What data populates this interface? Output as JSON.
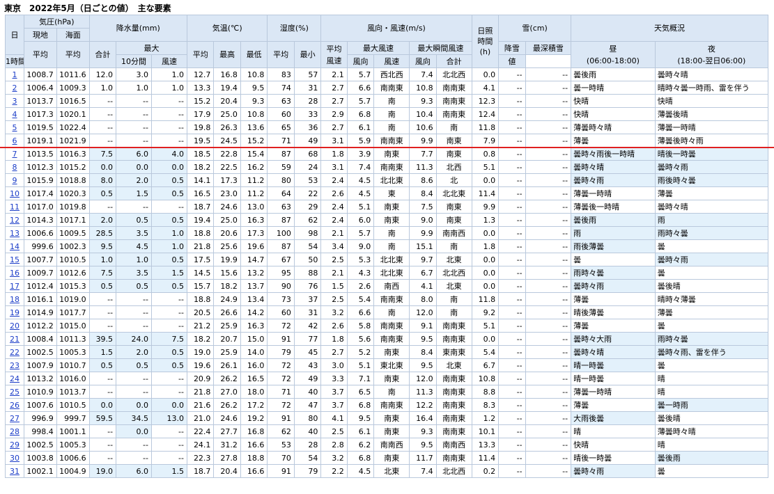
{
  "title": "東京　2022年5月（日ごとの値）　主な要素",
  "headers": {
    "day": "日",
    "pressure": "気圧(hPa)",
    "station": "現地",
    "sea": "海面",
    "precip": "降水量(mm)",
    "total": "合計",
    "max": "最大",
    "hour1": "1時間",
    "min10": "10分間",
    "temp": "気温(℃)",
    "humidity": "湿度(%)",
    "wind": "風向・風速(m/s)",
    "sun1": "日照",
    "sun2": "時間",
    "sun3": "(h)",
    "snow": "雪(cm)",
    "weather": "天気概況",
    "avg": "平均",
    "hi": "最高",
    "lo": "最低",
    "min": "最小",
    "avg_wind1": "平均",
    "avg_wind2": "風速",
    "max_wind": "最大風速",
    "gust": "最大瞬間風速",
    "speed": "風速",
    "dir": "風向",
    "snowfall": "降雪",
    "deep_snow": "最深積雪",
    "value": "値",
    "day_label": "昼",
    "day_range": "(06:00-18:00)",
    "night_label": "夜",
    "night_range": "(18:00-翌日06:00)"
  },
  "rows": [
    {
      "d": "1",
      "p1": "1008.7",
      "p2": "1011.6",
      "pt": "12.0",
      "ph": "3.0",
      "pm": "1.0",
      "ta": "12.7",
      "tx": "16.8",
      "tn": "10.8",
      "ha": "83",
      "hm": "57",
      "wa": "2.1",
      "wx": "5.7",
      "wxd": "西北西",
      "wg": "7.4",
      "wgd": "北北西",
      "sun": "0.0",
      "sn": "--",
      "sd": "--",
      "wd": "曇後雨",
      "wn": "曇時々晴",
      "hl": [
        false,
        false,
        false,
        false,
        false
      ]
    },
    {
      "d": "2",
      "p1": "1006.4",
      "p2": "1009.3",
      "pt": "1.0",
      "ph": "1.0",
      "pm": "1.0",
      "ta": "13.3",
      "tx": "19.4",
      "tn": "9.5",
      "ha": "74",
      "hm": "31",
      "wa": "2.7",
      "wx": "6.6",
      "wxd": "南南東",
      "wg": "10.8",
      "wgd": "南南東",
      "sun": "4.1",
      "sn": "--",
      "sd": "--",
      "wd": "曇一時晴",
      "wn": "晴時々曇一時雨、雷を伴う",
      "hl": [
        false,
        false,
        false,
        false,
        false
      ]
    },
    {
      "d": "3",
      "p1": "1013.7",
      "p2": "1016.5",
      "pt": "--",
      "ph": "--",
      "pm": "--",
      "ta": "15.2",
      "tx": "20.4",
      "tn": "9.3",
      "ha": "63",
      "hm": "28",
      "wa": "2.7",
      "wx": "5.7",
      "wxd": "南",
      "wg": "9.3",
      "wgd": "南南東",
      "sun": "12.3",
      "sn": "--",
      "sd": "--",
      "wd": "快晴",
      "wn": "快晴",
      "hl": [
        false,
        false,
        false,
        false,
        false
      ]
    },
    {
      "d": "4",
      "p1": "1017.3",
      "p2": "1020.1",
      "pt": "--",
      "ph": "--",
      "pm": "--",
      "ta": "17.9",
      "tx": "25.0",
      "tn": "10.8",
      "ha": "60",
      "hm": "33",
      "wa": "2.9",
      "wx": "6.8",
      "wxd": "南",
      "wg": "10.4",
      "wgd": "南南東",
      "sun": "12.4",
      "sn": "--",
      "sd": "--",
      "wd": "快晴",
      "wn": "薄曇後晴",
      "hl": [
        false,
        false,
        false,
        false,
        false
      ]
    },
    {
      "d": "5",
      "p1": "1019.5",
      "p2": "1022.4",
      "pt": "--",
      "ph": "--",
      "pm": "--",
      "ta": "19.8",
      "tx": "26.3",
      "tn": "13.6",
      "ha": "65",
      "hm": "36",
      "wa": "2.7",
      "wx": "6.1",
      "wxd": "南",
      "wg": "10.6",
      "wgd": "南",
      "sun": "11.8",
      "sn": "--",
      "sd": "--",
      "wd": "薄曇時々晴",
      "wn": "薄曇一時晴",
      "hl": [
        false,
        false,
        false,
        false,
        false
      ]
    },
    {
      "d": "6",
      "p1": "1019.1",
      "p2": "1021.9",
      "pt": "--",
      "ph": "--",
      "pm": "--",
      "ta": "19.5",
      "tx": "24.5",
      "tn": "15.2",
      "ha": "71",
      "hm": "49",
      "wa": "3.1",
      "wx": "5.9",
      "wxd": "南南東",
      "wg": "9.9",
      "wgd": "南東",
      "sun": "7.9",
      "sn": "--",
      "sd": "--",
      "wd": "薄曇",
      "wn": "薄曇後時々雨",
      "hl": [
        false,
        false,
        false,
        false,
        false
      ]
    },
    {
      "d": "7",
      "p1": "1013.5",
      "p2": "1016.3",
      "pt": "7.5",
      "ph": "6.0",
      "pm": "4.0",
      "ta": "18.5",
      "tx": "22.8",
      "tn": "15.4",
      "ha": "87",
      "hm": "68",
      "wa": "1.8",
      "wx": "3.9",
      "wxd": "南東",
      "wg": "7.7",
      "wgd": "南東",
      "sun": "0.8",
      "sn": "--",
      "sd": "--",
      "wd": "曇時々雨後一時晴",
      "wn": "晴後一時曇",
      "hl": [
        true,
        true,
        true,
        true,
        true
      ]
    },
    {
      "d": "8",
      "p1": "1012.3",
      "p2": "1015.2",
      "pt": "0.0",
      "ph": "0.0",
      "pm": "0.0",
      "ta": "18.2",
      "tx": "22.5",
      "tn": "16.2",
      "ha": "59",
      "hm": "24",
      "wa": "3.1",
      "wx": "7.4",
      "wxd": "南南東",
      "wg": "11.3",
      "wgd": "北西",
      "sun": "5.1",
      "sn": "--",
      "sd": "--",
      "wd": "曇時々晴",
      "wn": "曇時々雨",
      "hl": [
        true,
        true,
        true,
        true,
        true
      ]
    },
    {
      "d": "9",
      "p1": "1015.9",
      "p2": "1018.8",
      "pt": "8.0",
      "ph": "2.0",
      "pm": "0.5",
      "ta": "14.1",
      "tx": "17.3",
      "tn": "11.2",
      "ha": "80",
      "hm": "53",
      "wa": "2.4",
      "wx": "4.5",
      "wxd": "北北東",
      "wg": "8.6",
      "wgd": "北",
      "sun": "0.0",
      "sn": "--",
      "sd": "--",
      "wd": "曇時々雨",
      "wn": "雨後時々曇",
      "hl": [
        true,
        true,
        true,
        true,
        true
      ]
    },
    {
      "d": "10",
      "p1": "1017.4",
      "p2": "1020.3",
      "pt": "0.5",
      "ph": "1.5",
      "pm": "0.5",
      "ta": "16.5",
      "tx": "23.0",
      "tn": "11.2",
      "ha": "64",
      "hm": "22",
      "wa": "2.6",
      "wx": "4.5",
      "wxd": "東",
      "wg": "8.4",
      "wgd": "北北東",
      "sun": "11.4",
      "sn": "--",
      "sd": "--",
      "wd": "薄曇一時晴",
      "wn": "薄曇",
      "hl": [
        true,
        true,
        true,
        false,
        false
      ]
    },
    {
      "d": "11",
      "p1": "1017.0",
      "p2": "1019.8",
      "pt": "--",
      "ph": "--",
      "pm": "--",
      "ta": "18.7",
      "tx": "24.6",
      "tn": "13.0",
      "ha": "63",
      "hm": "29",
      "wa": "2.4",
      "wx": "5.1",
      "wxd": "南東",
      "wg": "7.5",
      "wgd": "南東",
      "sun": "9.9",
      "sn": "--",
      "sd": "--",
      "wd": "薄曇後一時晴",
      "wn": "曇時々晴",
      "hl": [
        false,
        false,
        false,
        false,
        false
      ]
    },
    {
      "d": "12",
      "p1": "1014.3",
      "p2": "1017.1",
      "pt": "2.0",
      "ph": "0.5",
      "pm": "0.5",
      "ta": "19.4",
      "tx": "25.0",
      "tn": "16.3",
      "ha": "87",
      "hm": "62",
      "wa": "2.4",
      "wx": "6.0",
      "wxd": "南東",
      "wg": "9.0",
      "wgd": "南東",
      "sun": "1.3",
      "sn": "--",
      "sd": "--",
      "wd": "曇後雨",
      "wn": "雨",
      "hl": [
        true,
        true,
        true,
        true,
        true
      ]
    },
    {
      "d": "13",
      "p1": "1006.6",
      "p2": "1009.5",
      "pt": "28.5",
      "ph": "3.5",
      "pm": "1.0",
      "ta": "18.8",
      "tx": "20.6",
      "tn": "17.3",
      "ha": "100",
      "hm": "98",
      "wa": "2.1",
      "wx": "5.7",
      "wxd": "南",
      "wg": "9.9",
      "wgd": "南南西",
      "sun": "0.0",
      "sn": "--",
      "sd": "--",
      "wd": "雨",
      "wn": "雨時々曇",
      "hl": [
        true,
        true,
        true,
        true,
        true
      ]
    },
    {
      "d": "14",
      "p1": "999.6",
      "p2": "1002.3",
      "pt": "9.5",
      "ph": "4.5",
      "pm": "1.0",
      "ta": "21.8",
      "tx": "25.6",
      "tn": "19.6",
      "ha": "87",
      "hm": "54",
      "wa": "3.4",
      "wx": "9.0",
      "wxd": "南",
      "wg": "15.1",
      "wgd": "南",
      "sun": "1.8",
      "sn": "--",
      "sd": "--",
      "wd": "雨後薄曇",
      "wn": "曇",
      "hl": [
        true,
        true,
        true,
        true,
        false
      ]
    },
    {
      "d": "15",
      "p1": "1007.7",
      "p2": "1010.5",
      "pt": "1.0",
      "ph": "1.0",
      "pm": "0.5",
      "ta": "17.5",
      "tx": "19.9",
      "tn": "14.7",
      "ha": "67",
      "hm": "50",
      "wa": "2.5",
      "wx": "5.3",
      "wxd": "北北東",
      "wg": "9.7",
      "wgd": "北東",
      "sun": "0.0",
      "sn": "--",
      "sd": "--",
      "wd": "曇",
      "wn": "曇時々雨",
      "hl": [
        true,
        true,
        true,
        false,
        true
      ]
    },
    {
      "d": "16",
      "p1": "1009.7",
      "p2": "1012.6",
      "pt": "7.5",
      "ph": "3.5",
      "pm": "1.5",
      "ta": "14.5",
      "tx": "15.6",
      "tn": "13.2",
      "ha": "95",
      "hm": "88",
      "wa": "2.1",
      "wx": "4.3",
      "wxd": "北北東",
      "wg": "6.7",
      "wgd": "北北西",
      "sun": "0.0",
      "sn": "--",
      "sd": "--",
      "wd": "雨時々曇",
      "wn": "曇",
      "hl": [
        true,
        true,
        true,
        true,
        false
      ]
    },
    {
      "d": "17",
      "p1": "1012.4",
      "p2": "1015.3",
      "pt": "0.5",
      "ph": "0.5",
      "pm": "0.5",
      "ta": "15.7",
      "tx": "18.2",
      "tn": "13.7",
      "ha": "90",
      "hm": "76",
      "wa": "1.5",
      "wx": "2.6",
      "wxd": "南西",
      "wg": "4.1",
      "wgd": "北東",
      "sun": "0.0",
      "sn": "--",
      "sd": "--",
      "wd": "曇時々雨",
      "wn": "曇後晴",
      "hl": [
        true,
        true,
        true,
        true,
        false
      ]
    },
    {
      "d": "18",
      "p1": "1016.1",
      "p2": "1019.0",
      "pt": "--",
      "ph": "--",
      "pm": "--",
      "ta": "18.8",
      "tx": "24.9",
      "tn": "13.4",
      "ha": "73",
      "hm": "37",
      "wa": "2.5",
      "wx": "5.4",
      "wxd": "南南東",
      "wg": "8.0",
      "wgd": "南",
      "sun": "11.8",
      "sn": "--",
      "sd": "--",
      "wd": "薄曇",
      "wn": "晴時々薄曇",
      "hl": [
        false,
        false,
        false,
        false,
        false
      ]
    },
    {
      "d": "19",
      "p1": "1014.9",
      "p2": "1017.7",
      "pt": "--",
      "ph": "--",
      "pm": "--",
      "ta": "20.5",
      "tx": "26.6",
      "tn": "14.2",
      "ha": "60",
      "hm": "31",
      "wa": "3.2",
      "wx": "6.6",
      "wxd": "南",
      "wg": "12.0",
      "wgd": "南",
      "sun": "9.2",
      "sn": "--",
      "sd": "--",
      "wd": "晴後薄曇",
      "wn": "薄曇",
      "hl": [
        false,
        false,
        false,
        false,
        false
      ]
    },
    {
      "d": "20",
      "p1": "1012.2",
      "p2": "1015.0",
      "pt": "--",
      "ph": "--",
      "pm": "--",
      "ta": "21.2",
      "tx": "25.9",
      "tn": "16.3",
      "ha": "72",
      "hm": "42",
      "wa": "2.6",
      "wx": "5.8",
      "wxd": "南南東",
      "wg": "9.1",
      "wgd": "南南東",
      "sun": "5.1",
      "sn": "--",
      "sd": "--",
      "wd": "薄曇",
      "wn": "曇",
      "hl": [
        false,
        false,
        false,
        false,
        false
      ]
    },
    {
      "d": "21",
      "p1": "1008.4",
      "p2": "1011.3",
      "pt": "39.5",
      "ph": "24.0",
      "pm": "7.5",
      "ta": "18.2",
      "tx": "20.7",
      "tn": "15.0",
      "ha": "91",
      "hm": "77",
      "wa": "1.8",
      "wx": "5.6",
      "wxd": "南南東",
      "wg": "9.5",
      "wgd": "南南東",
      "sun": "0.0",
      "sn": "--",
      "sd": "--",
      "wd": "曇時々大雨",
      "wn": "雨時々曇",
      "hl": [
        true,
        true,
        true,
        true,
        true
      ]
    },
    {
      "d": "22",
      "p1": "1002.5",
      "p2": "1005.3",
      "pt": "1.5",
      "ph": "2.0",
      "pm": "0.5",
      "ta": "19.0",
      "tx": "25.9",
      "tn": "14.0",
      "ha": "79",
      "hm": "45",
      "wa": "2.7",
      "wx": "5.2",
      "wxd": "南東",
      "wg": "8.4",
      "wgd": "東南東",
      "sun": "5.4",
      "sn": "--",
      "sd": "--",
      "wd": "曇時々晴",
      "wn": "曇時々雨、雷を伴う",
      "hl": [
        true,
        true,
        true,
        true,
        true
      ]
    },
    {
      "d": "23",
      "p1": "1007.9",
      "p2": "1010.7",
      "pt": "0.5",
      "ph": "0.5",
      "pm": "0.5",
      "ta": "19.6",
      "tx": "26.1",
      "tn": "16.0",
      "ha": "72",
      "hm": "43",
      "wa": "3.0",
      "wx": "5.1",
      "wxd": "東北東",
      "wg": "9.5",
      "wgd": "北東",
      "sun": "6.7",
      "sn": "--",
      "sd": "--",
      "wd": "晴一時曇",
      "wn": "曇",
      "hl": [
        true,
        true,
        true,
        true,
        false
      ]
    },
    {
      "d": "24",
      "p1": "1013.2",
      "p2": "1016.0",
      "pt": "--",
      "ph": "--",
      "pm": "--",
      "ta": "20.9",
      "tx": "26.2",
      "tn": "16.5",
      "ha": "72",
      "hm": "49",
      "wa": "3.3",
      "wx": "7.1",
      "wxd": "南東",
      "wg": "12.0",
      "wgd": "南南東",
      "sun": "10.8",
      "sn": "--",
      "sd": "--",
      "wd": "晴一時曇",
      "wn": "晴",
      "hl": [
        false,
        false,
        false,
        false,
        false
      ]
    },
    {
      "d": "25",
      "p1": "1010.9",
      "p2": "1013.7",
      "pt": "--",
      "ph": "--",
      "pm": "--",
      "ta": "21.8",
      "tx": "27.0",
      "tn": "18.0",
      "ha": "71",
      "hm": "40",
      "wa": "3.7",
      "wx": "6.5",
      "wxd": "南",
      "wg": "11.3",
      "wgd": "南南東",
      "sun": "8.8",
      "sn": "--",
      "sd": "--",
      "wd": "薄曇一時晴",
      "wn": "晴",
      "hl": [
        false,
        false,
        false,
        false,
        false
      ]
    },
    {
      "d": "26",
      "p1": "1007.6",
      "p2": "1010.5",
      "pt": "0.0",
      "ph": "0.0",
      "pm": "0.0",
      "ta": "21.6",
      "tx": "26.2",
      "tn": "17.2",
      "ha": "72",
      "hm": "47",
      "wa": "3.7",
      "wx": "6.8",
      "wxd": "南南東",
      "wg": "12.2",
      "wgd": "南南東",
      "sun": "8.3",
      "sn": "--",
      "sd": "--",
      "wd": "薄曇",
      "wn": "曇一時雨",
      "hl": [
        true,
        true,
        true,
        false,
        true
      ]
    },
    {
      "d": "27",
      "p1": "996.9",
      "p2": "999.7",
      "pt": "59.5",
      "ph": "34.5",
      "pm": "13.0",
      "ta": "21.0",
      "tx": "24.6",
      "tn": "19.2",
      "ha": "91",
      "hm": "80",
      "wa": "4.1",
      "wx": "9.5",
      "wxd": "南東",
      "wg": "16.4",
      "wgd": "南南東",
      "sun": "1.2",
      "sn": "--",
      "sd": "--",
      "wd": "大雨後曇",
      "wn": "曇後晴",
      "hl": [
        true,
        true,
        true,
        true,
        false
      ]
    },
    {
      "d": "28",
      "p1": "998.4",
      "p2": "1001.1",
      "pt": "--",
      "ph": "0.0",
      "pm": "--",
      "ta": "22.4",
      "tx": "27.7",
      "tn": "16.8",
      "ha": "62",
      "hm": "40",
      "wa": "2.5",
      "wx": "6.1",
      "wxd": "南東",
      "wg": "9.3",
      "wgd": "南南東",
      "sun": "10.1",
      "sn": "--",
      "sd": "--",
      "wd": "晴",
      "wn": "薄曇時々晴",
      "hl": [
        false,
        true,
        false,
        false,
        false
      ]
    },
    {
      "d": "29",
      "p1": "1002.5",
      "p2": "1005.3",
      "pt": "--",
      "ph": "--",
      "pm": "--",
      "ta": "24.1",
      "tx": "31.2",
      "tn": "16.6",
      "ha": "53",
      "hm": "28",
      "wa": "2.8",
      "wx": "6.2",
      "wxd": "南南西",
      "wg": "9.5",
      "wgd": "南南西",
      "sun": "13.3",
      "sn": "--",
      "sd": "--",
      "wd": "快晴",
      "wn": "晴",
      "hl": [
        false,
        false,
        false,
        false,
        false
      ]
    },
    {
      "d": "30",
      "p1": "1003.8",
      "p2": "1006.6",
      "pt": "--",
      "ph": "--",
      "pm": "--",
      "ta": "22.3",
      "tx": "27.8",
      "tn": "18.8",
      "ha": "70",
      "hm": "54",
      "wa": "3.2",
      "wx": "6.8",
      "wxd": "南東",
      "wg": "11.7",
      "wgd": "南南東",
      "sun": "11.4",
      "sn": "--",
      "sd": "--",
      "wd": "晴後一時曇",
      "wn": "曇後雨",
      "hl": [
        false,
        false,
        false,
        false,
        true
      ]
    },
    {
      "d": "31",
      "p1": "1002.1",
      "p2": "1004.9",
      "pt": "19.0",
      "ph": "6.0",
      "pm": "1.5",
      "ta": "18.7",
      "tx": "20.4",
      "tn": "16.6",
      "ha": "91",
      "hm": "79",
      "wa": "2.2",
      "wx": "4.5",
      "wxd": "北東",
      "wg": "7.4",
      "wgd": "北北西",
      "sun": "0.2",
      "sn": "--",
      "sd": "--",
      "wd": "曇時々雨",
      "wn": "曇",
      "hl": [
        true,
        true,
        true,
        true,
        false
      ]
    }
  ]
}
